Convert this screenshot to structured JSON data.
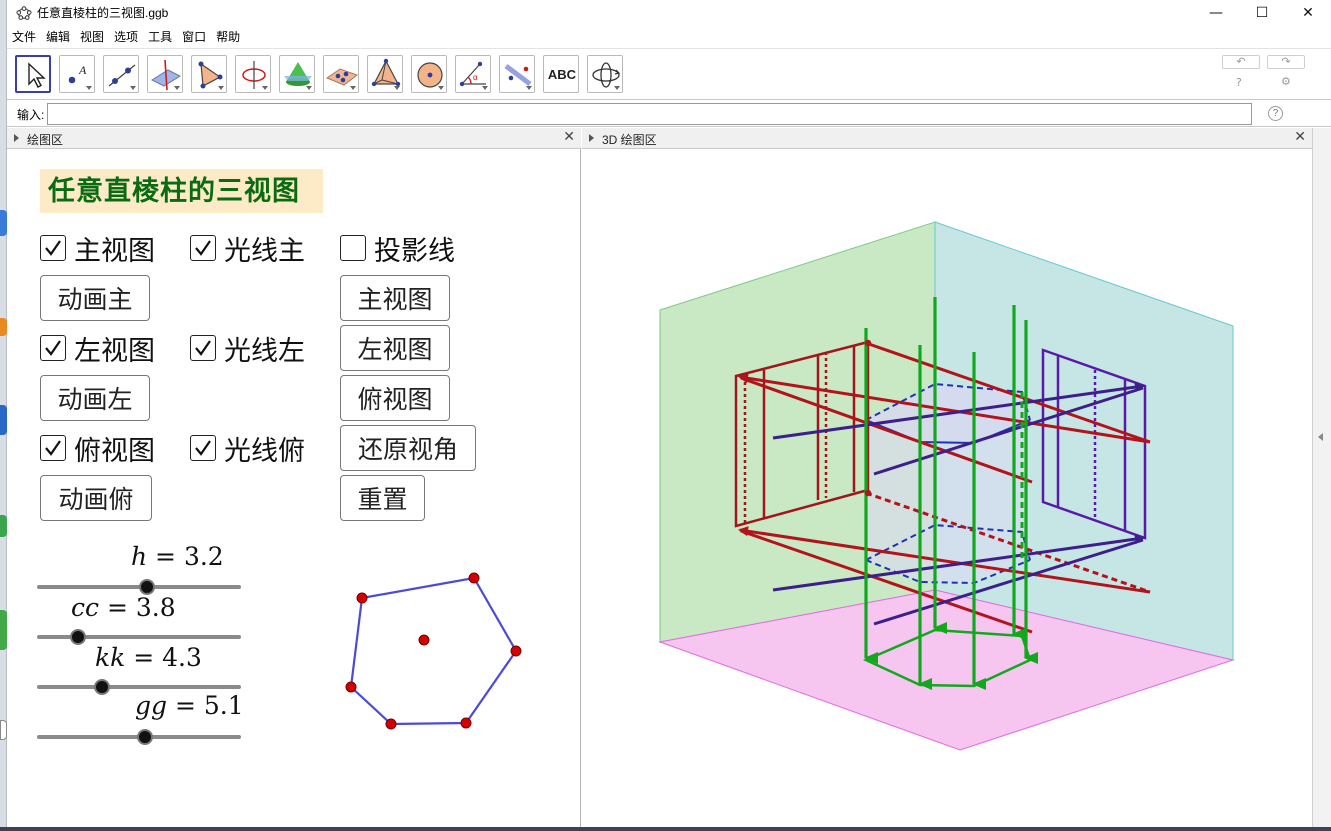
{
  "window": {
    "title": "任意直棱柱的三视图.ggb",
    "minimize": "—",
    "maximize": "☐",
    "close": "✕"
  },
  "menu": [
    "文件",
    "编辑",
    "视图",
    "选项",
    "工具",
    "窗口",
    "帮助"
  ],
  "toolbar": {
    "tools": [
      {
        "name": "move-tool",
        "label": ""
      },
      {
        "name": "point-tool",
        "label": ""
      },
      {
        "name": "line-tool",
        "label": ""
      },
      {
        "name": "perpendicular-tool",
        "label": ""
      },
      {
        "name": "polygon-tool",
        "label": ""
      },
      {
        "name": "circle-axis-tool",
        "label": ""
      },
      {
        "name": "intersect-surface-tool",
        "label": ""
      },
      {
        "name": "plane-tool",
        "label": ""
      },
      {
        "name": "pyramid-tool",
        "label": ""
      },
      {
        "name": "sphere-tool",
        "label": ""
      },
      {
        "name": "angle-tool",
        "label": ""
      },
      {
        "name": "reflect-tool",
        "label": ""
      },
      {
        "name": "text-tool",
        "label": "ABC"
      },
      {
        "name": "rotate-view-tool",
        "label": ""
      }
    ],
    "undo": "↶",
    "redo": "↷",
    "help": "?",
    "settings": "⚙"
  },
  "input": {
    "label": "输入:",
    "value": "",
    "help": "?"
  },
  "panels": {
    "left_title": "绘图区",
    "right_title": "3D 绘图区",
    "close": "✕"
  },
  "sheet": {
    "title": "任意直棱柱的三视图",
    "checkboxes": [
      {
        "label": "主视图",
        "checked": true
      },
      {
        "label": "光线主",
        "checked": true
      },
      {
        "label": "投影线",
        "checked": false
      },
      {
        "label": "左视图",
        "checked": true
      },
      {
        "label": "光线左",
        "checked": true
      },
      {
        "label": "俯视图",
        "checked": true
      },
      {
        "label": "光线俯",
        "checked": true
      }
    ],
    "buttons": {
      "anim_front": "动画主",
      "front_view": "主视图",
      "side_view": "左视图",
      "anim_left": "动画左",
      "top_view": "俯视图",
      "anim_top": "动画俯",
      "reset_angle": "还原视角",
      "reset": "重置"
    },
    "sliders": [
      {
        "var": "h",
        "value": "3.2",
        "fraction": 0.54
      },
      {
        "var": "cc",
        "value": "3.8",
        "fraction": 0.2
      },
      {
        "var": "kk",
        "value": "4.3",
        "fraction": 0.32
      },
      {
        "var": "gg",
        "value": "5.1",
        "fraction": 0.53
      }
    ]
  },
  "colors": {
    "title_green": "#0b6b13",
    "title_bg": "#fdebc8",
    "front_red": "#b3131b",
    "side_purple": "#5a1aa8",
    "top_green": "#12a81e",
    "polygon_blue": "#4b4bd6",
    "point_red": "#d40000",
    "wall_green": "#c9e8c4",
    "wall_cyan": "#c6e6e6",
    "floor_pink": "#f6c6f1"
  }
}
